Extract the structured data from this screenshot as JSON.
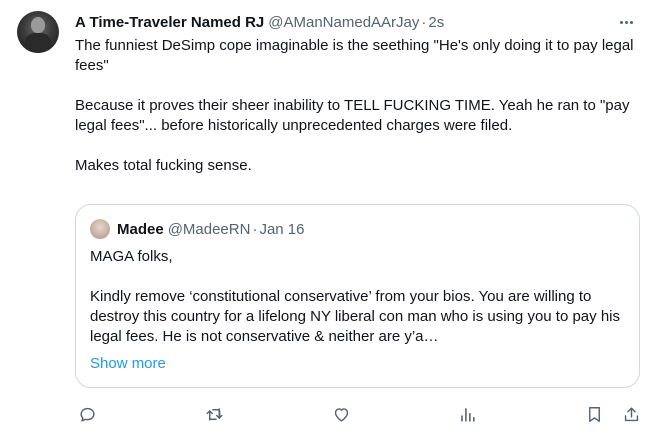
{
  "tweet": {
    "display_name": "A Time-Traveler Named RJ",
    "handle": "@AManNamedAArJay",
    "separator": "·",
    "time": "2s",
    "paragraphs": [
      "The funniest DeSimp cope imaginable is the seething \"He's only doing it to pay legal fees\"",
      "Because it proves their sheer inability to TELL FUCKING TIME. Yeah he ran to \"pay legal fees\"... before historically unprecedented charges were filed.",
      "Makes total fucking sense."
    ]
  },
  "quote": {
    "display_name": "Madee",
    "handle": "@MadeeRN",
    "separator": "·",
    "time": "Jan 16",
    "paragraphs": [
      "MAGA folks,",
      "Kindly remove ‘constitutional conservative’ from your bios. You are willing to destroy this country for a lifelong NY liberal con man who is using you to pay his legal fees. He is not conservative & neither are y’a…"
    ],
    "show_more": "Show more"
  },
  "actions": {
    "icons": [
      "reply-icon",
      "retweet-icon",
      "like-icon",
      "views-icon",
      "bookmark-icon",
      "share-icon"
    ],
    "icon_color": "#536471"
  },
  "colors": {
    "text": "#0f1419",
    "secondary": "#536471",
    "link": "#1d9bf0",
    "border": "#cfd9de"
  }
}
